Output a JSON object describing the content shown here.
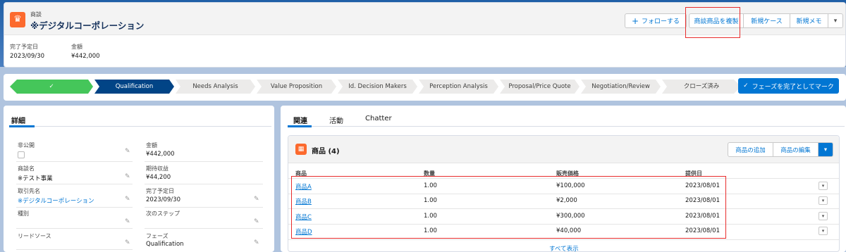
{
  "header": {
    "object_label": "商談",
    "record_name": "※デジタルコーポレーション",
    "buttons": {
      "follow": "フォローする",
      "duplicate": "商談商品を複製",
      "new_case": "新規ケース",
      "new_memo": "新規メモ"
    },
    "fields": [
      {
        "label": "完了予定日",
        "value": "2023/09/30"
      },
      {
        "label": "金額",
        "value": "¥442,000"
      }
    ]
  },
  "path": {
    "stages": [
      "",
      "Qualification",
      "Needs Analysis",
      "Value Proposition",
      "Id. Decision Makers",
      "Perception Analysis",
      "Proposal/Price Quote",
      "Negotiation/Review",
      "クローズ済み"
    ],
    "complete_button": "フェーズを完了としてマーク"
  },
  "details": {
    "tab": "詳細",
    "fields": {
      "private": {
        "label": "非公開"
      },
      "opp_name": {
        "label": "商談名",
        "value": "※テスト事業"
      },
      "account": {
        "label": "取引先名",
        "value": "※デジタルコーポレーション"
      },
      "type": {
        "label": "種別",
        "value": ""
      },
      "lead_source": {
        "label": "リードソース",
        "value": ""
      },
      "amount": {
        "label": "金額",
        "value": "¥442,000"
      },
      "expected_revenue": {
        "label": "期待収益",
        "value": "¥44,200"
      },
      "close_date": {
        "label": "完了予定日",
        "value": "2023/09/30"
      },
      "next_step": {
        "label": "次のステップ",
        "value": ""
      },
      "stage": {
        "label": "フェーズ",
        "value": "Qualification"
      }
    }
  },
  "related": {
    "tabs": [
      "関連",
      "活動",
      "Chatter"
    ],
    "products": {
      "title": "商品 (4)",
      "add_button": "商品の追加",
      "edit_button": "商品の編集",
      "columns": [
        "商品",
        "数量",
        "販売価格",
        "提供日"
      ],
      "rows": [
        [
          "商品A",
          "1.00",
          "¥100,000",
          "2023/08/01"
        ],
        [
          "商品B",
          "1.00",
          "¥2,000",
          "2023/08/01"
        ],
        [
          "商品C",
          "1.00",
          "¥300,000",
          "2023/08/01"
        ],
        [
          "商品D",
          "1.00",
          "¥40,000",
          "2023/08/01"
        ]
      ],
      "view_all": "すべて表示"
    }
  }
}
